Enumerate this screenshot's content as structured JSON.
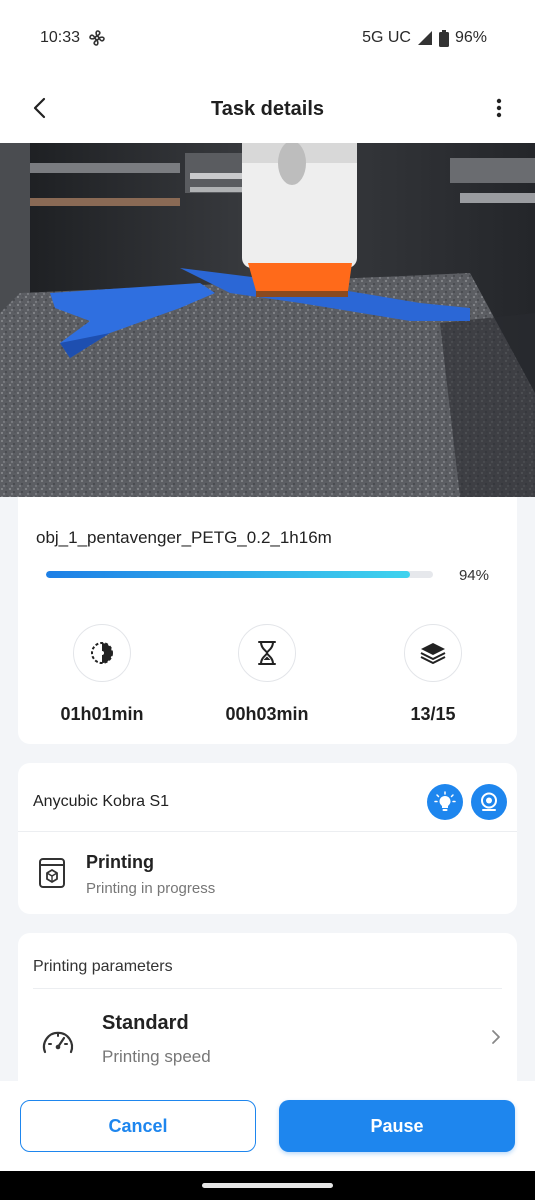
{
  "status_bar": {
    "time": "10:33",
    "network": "5G UC",
    "battery": "96%"
  },
  "app_bar": {
    "title": "Task details"
  },
  "job": {
    "file_name": "obj_1_pentavenger_PETG_0.2_1h16m",
    "progress_percent": 94,
    "progress_label": "94%",
    "elapsed_time": "01h01min",
    "remaining_time": "00h03min",
    "layers": "13/15"
  },
  "printer": {
    "name": "Anycubic Kobra S1",
    "status_title": "Printing",
    "status_subtitle": "Printing in progress"
  },
  "params": {
    "section_title": "Printing parameters",
    "speed_value": "Standard",
    "speed_label": "Printing speed"
  },
  "actions": {
    "cancel_label": "Cancel",
    "pause_label": "Pause"
  },
  "colors": {
    "accent": "#1e86ee",
    "progress_start": "#1d7fe6",
    "progress_end": "#3fd3ee"
  }
}
